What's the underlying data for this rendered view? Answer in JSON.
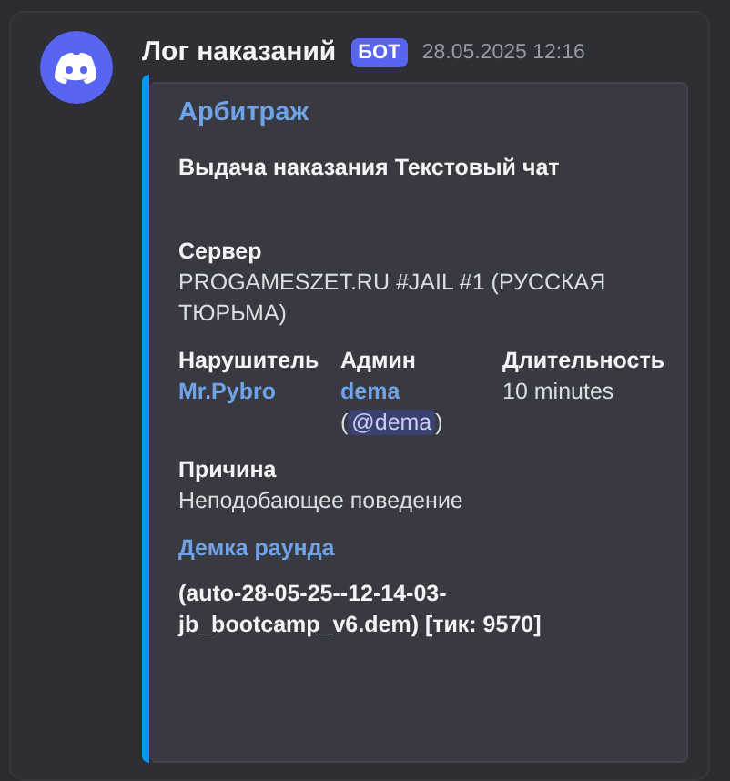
{
  "message": {
    "author": "Лог наказаний",
    "bot_tag": "БОТ",
    "timestamp": "28.05.2025 12:16"
  },
  "embed": {
    "color": "#0a96f5",
    "title": "Арбитраж",
    "description": "Выдача наказания Текстовый чат",
    "fields": [
      {
        "kind": "plain",
        "inline": false,
        "name": "Сервер",
        "lines": [
          [
            {
              "kind": "text",
              "text": "PROGAMESZET.RU #JAIL #1 (РУССКАЯ ТЮРЬМА)"
            }
          ]
        ]
      },
      {
        "kind": "plain",
        "inline": true,
        "name": "Нарушитель",
        "lines": [
          [
            {
              "kind": "link",
              "text": "Mr.Pybro"
            }
          ]
        ]
      },
      {
        "kind": "plain",
        "inline": true,
        "name": "Админ",
        "lines": [
          [
            {
              "kind": "link",
              "text": "dema"
            }
          ],
          [
            {
              "kind": "text",
              "text": "("
            },
            {
              "kind": "mention",
              "text": "@dema"
            },
            {
              "kind": "text",
              "text": ")"
            }
          ]
        ]
      },
      {
        "kind": "plain",
        "inline": true,
        "name": "Длительность",
        "lines": [
          [
            {
              "kind": "text",
              "text": "10 minutes"
            }
          ]
        ]
      },
      {
        "kind": "plain",
        "inline": false,
        "name": "Причина",
        "lines": [
          [
            {
              "kind": "text",
              "text": "Неподобающее поведение"
            }
          ]
        ]
      },
      {
        "kind": "linked",
        "inline": false,
        "name": "Демка раунда",
        "lines": [
          [
            {
              "kind": "bold",
              "text": "(auto-28-05-25--12-14-03-jb_bootcamp_v6.dem) [тик: 9570]"
            }
          ]
        ]
      }
    ]
  }
}
